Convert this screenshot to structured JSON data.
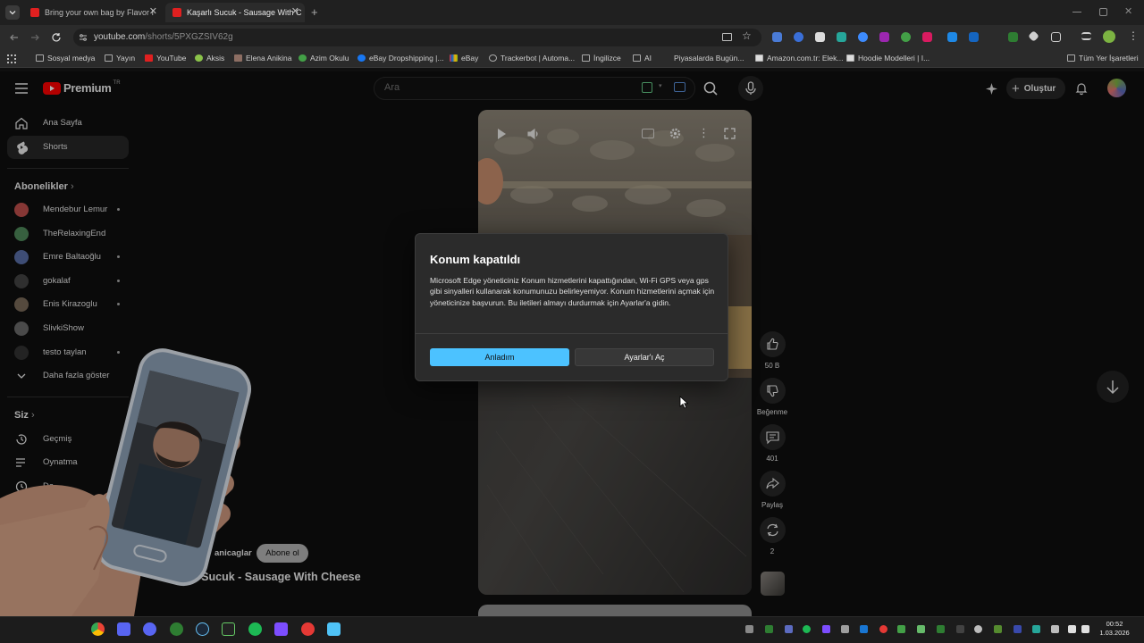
{
  "browser": {
    "tabs": [
      {
        "title": "Bring your own bag by Flavor I",
        "active": false
      },
      {
        "title": "Kaşarlı Sucuk - Sausage With C",
        "active": true
      }
    ],
    "new_tab_symbol": "+",
    "url_host": "youtube.com",
    "url_path": "/shorts/5PXGZSIV62g",
    "bookmarks": [
      "Sosyal medya",
      "Yayın",
      "YouTube",
      "Aksis",
      "Elena Anikina",
      "Azim Okulu",
      "eBay Dropshipping |...",
      "eBay",
      "Trackerbot | Automa...",
      "İngilizce",
      "AI",
      "Piyasalarda Bugün...",
      "Amazon.com.tr: Elek...",
      "Hoodie Modelleri | I...",
      "Tüm Yer İşaretleri"
    ]
  },
  "youtube": {
    "logo_text": "Premium",
    "logo_sup": "TR",
    "search_placeholder": "Ara",
    "create_label": "Oluştur"
  },
  "sidebar": {
    "nav": [
      {
        "label": "Ana Sayfa",
        "icon": "home-icon"
      },
      {
        "label": "Shorts",
        "icon": "shorts-icon",
        "selected": true
      }
    ],
    "subs_heading": "Abonelikler",
    "subscriptions": [
      {
        "label": "Mendebur Lemur",
        "dot": true,
        "color": "#c0504d"
      },
      {
        "label": "TheRelaxingEnd",
        "dot": false,
        "color": "#4f8a5b"
      },
      {
        "label": "Emre Baltaoğlu",
        "dot": true,
        "color": "#5a6fa8"
      },
      {
        "label": "gokalaf",
        "dot": true,
        "color": "#444444"
      },
      {
        "label": "Enis Kirazoglu",
        "dot": true,
        "color": "#7a6a5a"
      },
      {
        "label": "SlivkiShow",
        "dot": false,
        "color": "#6a6a6a"
      },
      {
        "label": "testo taylan",
        "dot": true,
        "color": "#333333"
      }
    ],
    "more_label": "Daha fazla göster",
    "you_heading": "Siz",
    "you_items": [
      {
        "label": "Geçmiş",
        "icon": "history-icon"
      },
      {
        "label": "Oynatma",
        "icon": "playlist-icon"
      },
      {
        "label": "Da",
        "icon": "clock-icon"
      },
      {
        "label": "B",
        "icon": "like-icon"
      },
      {
        "label": "",
        "icon": "video-icon"
      }
    ]
  },
  "short": {
    "channel_name": "anicaglar",
    "subscribe_label": "Abone ol",
    "title": "Kaşarlı Sucuk - Sausage With Cheese",
    "likes": "50 B",
    "dislike_label": "Beğenme",
    "comments": "401",
    "share_label": "Paylaş",
    "remix_count": "2"
  },
  "dialog": {
    "title": "Konum kapatıldı",
    "body": "Microsoft Edge yöneticiniz Konum hizmetlerini kapattığından, Wi-Fi GPS veya gps gibi sinyalleri kullanarak konumunuzu belirleyemiyor. Konum hizmetlerini açmak için yöneticinize başvurun. Bu iletileri almayı durdurmak için Ayarlar'a gidin.",
    "ok_label": "Anladım",
    "settings_label": "Ayarlar'ı Aç"
  },
  "taskbar": {
    "time": "00:52",
    "date": "1.03.2026"
  },
  "colors": {
    "accent_button": "#4cc2ff",
    "youtube_red": "#ff0000"
  }
}
